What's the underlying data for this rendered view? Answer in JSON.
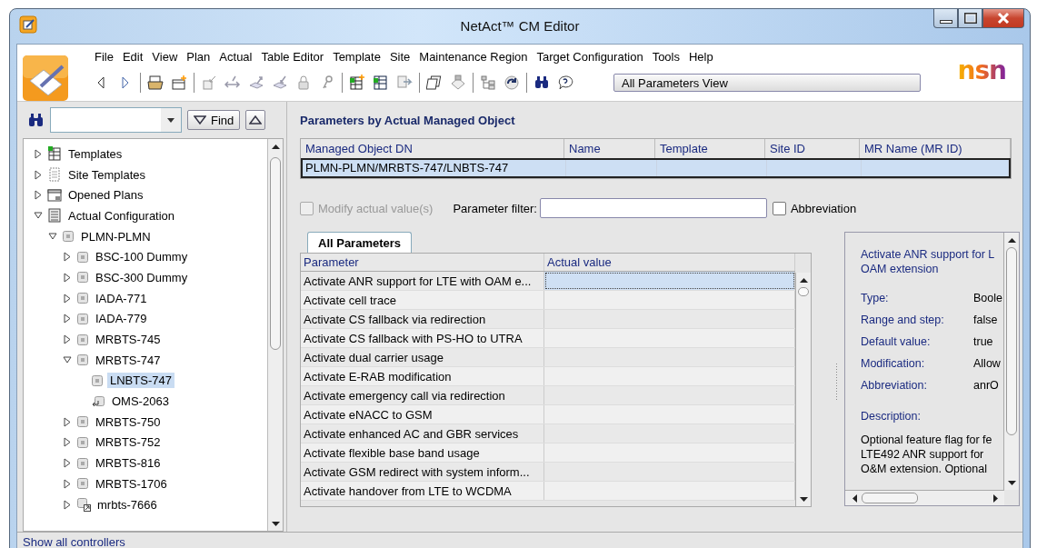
{
  "window": {
    "title": "NetAct™ CM Editor"
  },
  "menu": [
    "File",
    "Edit",
    "View",
    "Plan",
    "Actual",
    "Table Editor",
    "Template",
    "Site",
    "Maintenance Region",
    "Target Configuration",
    "Tools",
    "Help"
  ],
  "view_selector": {
    "value": "All Parameters View"
  },
  "brand": "nsn",
  "search": {
    "find_button": "Find"
  },
  "tree": [
    {
      "label": "Templates",
      "kind": "templates",
      "expanded": false,
      "selected": false
    },
    {
      "label": "Site Templates",
      "kind": "site-templates",
      "expanded": false,
      "selected": false
    },
    {
      "label": "Opened Plans",
      "kind": "plans",
      "expanded": false,
      "selected": false
    },
    {
      "label": "Actual Configuration",
      "kind": "actual",
      "expanded": true,
      "selected": false,
      "children": [
        {
          "label": "PLMN-PLMN",
          "kind": "object",
          "expanded": true,
          "selected": false,
          "children": [
            {
              "label": "BSC-100 Dummy",
              "kind": "object",
              "expanded": false,
              "selected": false
            },
            {
              "label": "BSC-300 Dummy",
              "kind": "object",
              "expanded": false,
              "selected": false
            },
            {
              "label": "IADA-771",
              "kind": "object",
              "expanded": false,
              "selected": false
            },
            {
              "label": "IADA-779",
              "kind": "object",
              "expanded": false,
              "selected": false
            },
            {
              "label": "MRBTS-745",
              "kind": "object",
              "expanded": false,
              "selected": false
            },
            {
              "label": "MRBTS-747",
              "kind": "object",
              "expanded": true,
              "selected": false,
              "children": [
                {
                  "label": "LNBTS-747",
                  "kind": "object",
                  "selected": true
                },
                {
                  "label": "OMS-2063",
                  "kind": "link",
                  "selected": false
                }
              ]
            },
            {
              "label": "MRBTS-750",
              "kind": "object",
              "expanded": false,
              "selected": false
            },
            {
              "label": "MRBTS-752",
              "kind": "object",
              "expanded": false,
              "selected": false
            },
            {
              "label": "MRBTS-816",
              "kind": "object",
              "expanded": false,
              "selected": false
            },
            {
              "label": "MRBTS-1706",
              "kind": "object",
              "expanded": false,
              "selected": false
            },
            {
              "label": "mrbts-7666",
              "kind": "shortcut",
              "expanded": false,
              "selected": false
            }
          ]
        }
      ]
    }
  ],
  "status_bar": {
    "link": "Show all controllers"
  },
  "heading": "Parameters by Actual Managed Object",
  "object_table": {
    "columns": [
      "Managed Object DN",
      "Name",
      "Template",
      "Site ID",
      "MR Name (MR ID)"
    ],
    "rows": [
      {
        "cells": [
          "PLMN-PLMN/MRBTS-747/LNBTS-747"
        ],
        "selected": true
      }
    ]
  },
  "modify_checkbox": {
    "label": "Modify actual value(s)",
    "checked": false,
    "disabled": true
  },
  "parameter_filter": {
    "label": "Parameter filter:"
  },
  "abbreviation_checkbox": {
    "label": "Abbreviation",
    "checked": false,
    "disabled": false
  },
  "tabs": [
    {
      "label": "All Parameters",
      "selected": true
    }
  ],
  "parameter_table": {
    "columns": [
      "Parameter",
      "Actual value"
    ],
    "rows": [
      {
        "parameter": "Activate ANR support for LTE with OAM e...",
        "selected": true
      },
      {
        "parameter": "Activate cell trace",
        "selected": false
      },
      {
        "parameter": "Activate CS fallback via redirection",
        "selected": false
      },
      {
        "parameter": "Activate CS fallback with PS-HO to UTRA",
        "selected": false
      },
      {
        "parameter": "Activate dual carrier usage",
        "selected": false
      },
      {
        "parameter": "Activate E-RAB modification",
        "selected": false
      },
      {
        "parameter": "Activate emergency call via redirection",
        "selected": false
      },
      {
        "parameter": "Activate eNACC to GSM",
        "selected": false
      },
      {
        "parameter": "Activate enhanced AC and GBR services",
        "selected": false
      },
      {
        "parameter": "Activate flexible base band usage",
        "selected": false
      },
      {
        "parameter": "Activate GSM redirect with system inform...",
        "selected": false
      },
      {
        "parameter": "Activate handover from LTE to WCDMA",
        "selected": false
      }
    ]
  },
  "details": {
    "title_lines": [
      "Activate ANR support for L",
      "OAM extension"
    ],
    "properties": [
      {
        "label": "Type:",
        "value": "Boole"
      },
      {
        "label": "Range and step:",
        "value": "false"
      },
      {
        "label": "Default value:",
        "value": "true"
      },
      {
        "label": "Modification:",
        "value": "Allow"
      },
      {
        "label": "Abbreviation:",
        "value": "anrO"
      }
    ],
    "description_label": "Description:",
    "description_lines": [
      "Optional feature flag for fe",
      "LTE492 ANR support for",
      "O&M extension. Optional"
    ]
  }
}
